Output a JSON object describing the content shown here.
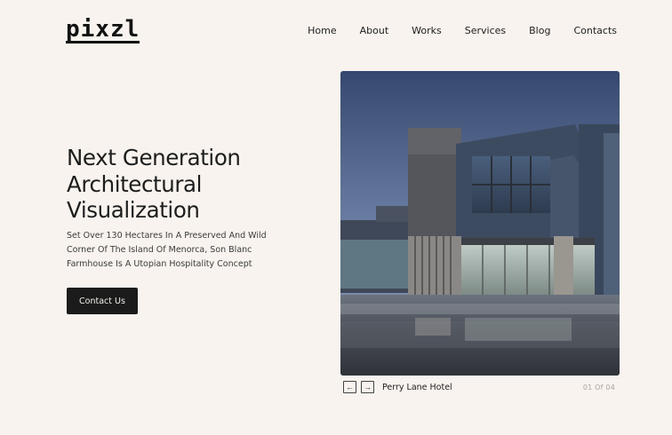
{
  "brand": {
    "logo": "pixzl"
  },
  "nav": {
    "items": [
      "Home",
      "About",
      "Works",
      "Services",
      "Blog",
      "Contacts"
    ]
  },
  "hero": {
    "title_lines": [
      "Next Generation",
      "Architectural",
      "Visualization"
    ],
    "description_lines": [
      "Set Over 130 Hectares In A Preserved And Wild",
      "Corner Of The Island Of Menorca, Son Blanc",
      "Farmhouse Is A Utopian Hospitality Concept"
    ],
    "cta_label": "Contact Us"
  },
  "slider": {
    "prev_icon": "←",
    "next_icon": "→",
    "caption": "Perry Lane Hotel",
    "counter": "01 Of 04"
  },
  "colors": {
    "background": "#f8f3ee",
    "button": "#1b1b1b",
    "text": "#1c1c1c"
  }
}
